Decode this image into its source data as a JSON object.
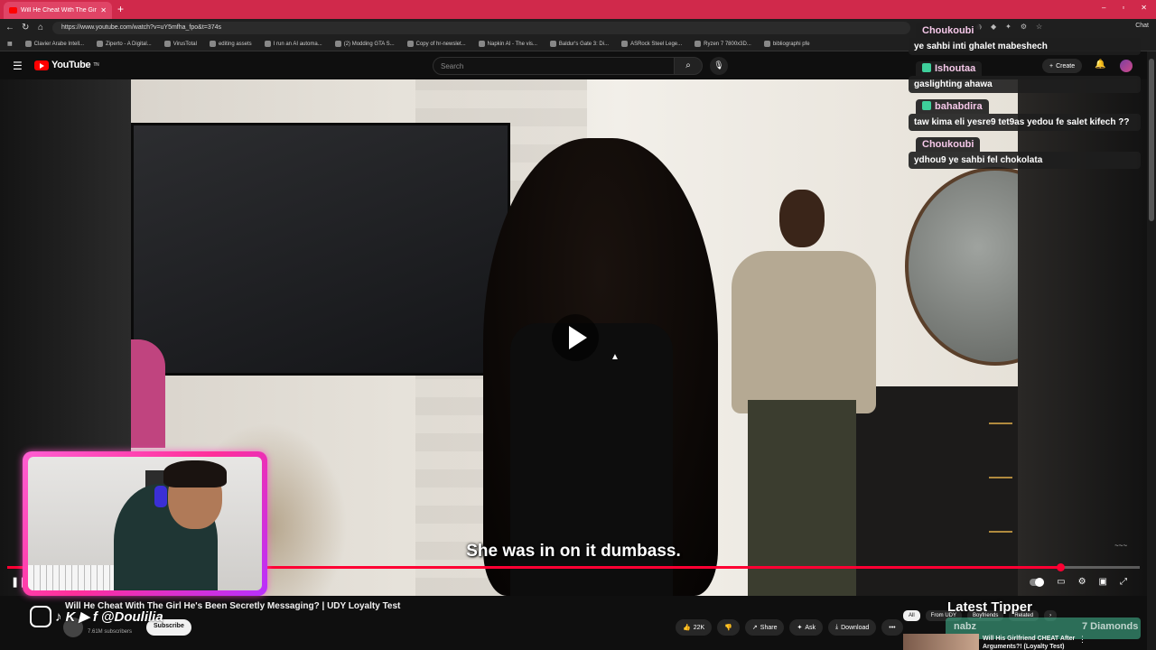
{
  "browser": {
    "tab_title": "Will He Cheat With The Girl H...",
    "new_tab": "+",
    "win_min": "–",
    "win_max": "▫",
    "win_close": "✕",
    "url": "https://www.youtube.com/watch?v=uY5mfha_fpo&t=374s",
    "chat_label": "Chat",
    "bookmarks": [
      "Clavier Arabe Intell...",
      "Ziperto - A Digital...",
      "VirusTotal",
      "editing assets",
      "I run an AI automa...",
      "(2) Modding GTA S...",
      "Copy of hr-newslet...",
      "Napkin AI - The vis...",
      "Baldur's Gate 3: Di...",
      "ASRock Steel Lege...",
      "Ryzen 7 7800x3D...",
      "bibliographi pfe"
    ]
  },
  "youtube": {
    "logo": "YouTube",
    "logo_sup": "TN",
    "search_placeholder": "Search",
    "create_label": "Create"
  },
  "video": {
    "subtitle": "She was in on it dumbass.",
    "progress_fraction": 0.93,
    "watermark": "~~~"
  },
  "below": {
    "title": "Will He Cheat With The Girl He's Been Secretly Messaging? | UDY Loyalty Test",
    "social_handle": "@Doulilia",
    "subscribe": "Subscribe",
    "subscribers": "7.61M subscribers",
    "likes": "22K",
    "share": "Share",
    "ask": "Ask",
    "download": "Download",
    "more": "•••",
    "chips": [
      "All",
      "From UDY",
      "Boyfriends",
      "Related"
    ],
    "chip_next": "›",
    "rec_title": "Will His Girlfriend CHEAT After Arguments?! (Loyalty Test)",
    "rec_more": "⋮"
  },
  "tipper": {
    "heading": "Latest Tipper",
    "name": "nabz",
    "amount": "7 Diamonds"
  },
  "chat": [
    {
      "user": "Choukoubi",
      "text": "ye sahbi inti ghalet mabeshech",
      "badge": false
    },
    {
      "user": "Ishoutaa",
      "text": "gaslighting ahawa",
      "badge": true
    },
    {
      "user": "bahabdira",
      "text": "taw kima eli yesre9 tet9as yedou fe salet kifech ??",
      "badge": true
    },
    {
      "user": "Choukoubi",
      "text": "ydhou9 ye sahbi fel chokolata",
      "badge": false
    }
  ]
}
